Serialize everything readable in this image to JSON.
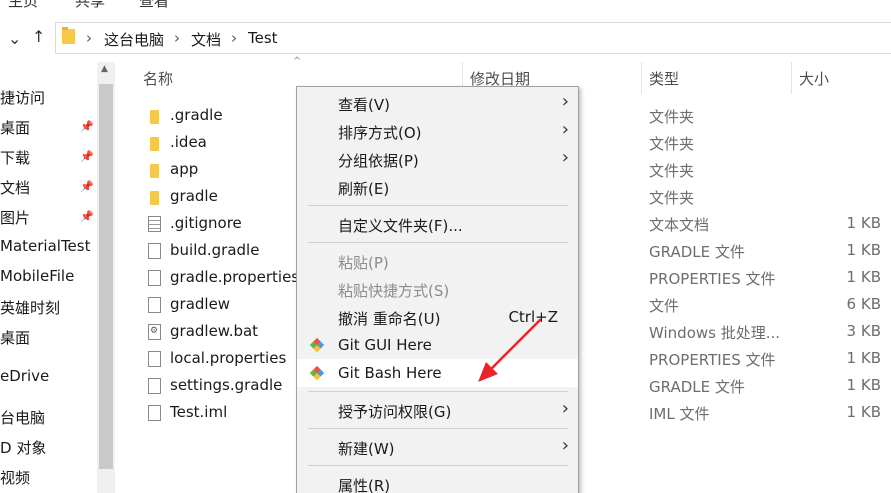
{
  "ribbon": {
    "tabs": [
      "主页",
      "共享",
      "查看"
    ]
  },
  "address": {
    "crumbs": [
      "这台电脑",
      "文档",
      "Test"
    ]
  },
  "nav": {
    "items": [
      {
        "label": "捷访问",
        "pinned": false
      },
      {
        "label": "桌面",
        "pinned": true
      },
      {
        "label": "下载",
        "pinned": true
      },
      {
        "label": "文档",
        "pinned": true
      },
      {
        "label": "图片",
        "pinned": true
      },
      {
        "label": "MaterialTest",
        "pinned": false
      },
      {
        "label": "MobileFile",
        "pinned": false
      },
      {
        "label": "英雄时刻",
        "pinned": false
      },
      {
        "label": "桌面",
        "pinned": false
      },
      {
        "label": "eDrive",
        "pinned": false
      },
      {
        "label": "台电脑",
        "pinned": false
      },
      {
        "label": "D 对象",
        "pinned": false
      },
      {
        "label": "视频",
        "pinned": false
      }
    ]
  },
  "columns": {
    "name": "名称",
    "date": "修改日期",
    "type": "类型",
    "size": "大小"
  },
  "files": [
    {
      "name": ".gradle",
      "type": "文件夹",
      "size": "",
      "icon": "folder"
    },
    {
      "name": ".idea",
      "type": "文件夹",
      "size": "",
      "icon": "folder"
    },
    {
      "name": "app",
      "type": "文件夹",
      "size": "",
      "icon": "folder"
    },
    {
      "name": "gradle",
      "type": "文件夹",
      "size": "",
      "icon": "folder"
    },
    {
      "name": ".gitignore",
      "type": "文本文档",
      "size": "1 KB",
      "icon": "txt"
    },
    {
      "name": "build.gradle",
      "type": "GRADLE 文件",
      "size": "1 KB",
      "icon": "doc"
    },
    {
      "name": "gradle.properties",
      "type": "PROPERTIES 文件",
      "size": "1 KB",
      "icon": "doc"
    },
    {
      "name": "gradlew",
      "type": "文件",
      "size": "6 KB",
      "icon": "doc"
    },
    {
      "name": "gradlew.bat",
      "type": "Windows 批处理...",
      "size": "3 KB",
      "icon": "bat"
    },
    {
      "name": "local.properties",
      "type": "PROPERTIES 文件",
      "size": "1 KB",
      "icon": "doc"
    },
    {
      "name": "settings.gradle",
      "type": "GRADLE 文件",
      "size": "1 KB",
      "icon": "doc"
    },
    {
      "name": "Test.iml",
      "type": "IML 文件",
      "size": "1 KB",
      "icon": "doc"
    }
  ],
  "context_menu": {
    "view": "查看(V)",
    "sort": "排序方式(O)",
    "group": "分组依据(P)",
    "refresh": "刷新(E)",
    "customize": "自定义文件夹(F)...",
    "paste": "粘贴(P)",
    "paste_shortcut": "粘贴快捷方式(S)",
    "undo_rename": "撤消 重命名(U)",
    "undo_shortcut": "Ctrl+Z",
    "git_gui": "Git GUI Here",
    "git_bash": "Git Bash Here",
    "grant_access": "授予访问权限(G)",
    "new": "新建(W)",
    "properties": "属性(R)"
  },
  "colors": {
    "folder": "#f5c84a",
    "annotation_arrow": "#e8262a",
    "menu_bg": "#f2f2f2"
  }
}
